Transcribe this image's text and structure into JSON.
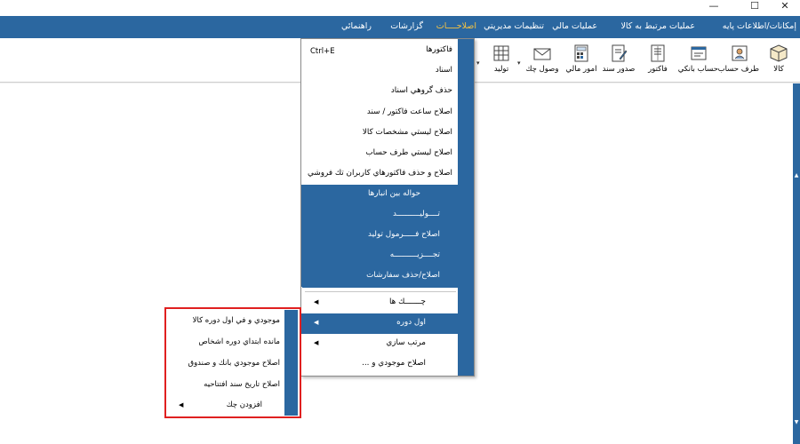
{
  "window": {
    "controls": {
      "minimize": "—",
      "maximize": "☐",
      "close": "✕"
    }
  },
  "menubar": {
    "items": [
      {
        "label": "إمكانات/اطلاعات پايه"
      },
      {
        "label": "عمليات مرتبط به كالا"
      },
      {
        "label": "عمليات مالي"
      },
      {
        "label": "تنظيمات مديريتي"
      },
      {
        "label": "اصلاحــــات"
      },
      {
        "label": "گزارشات"
      },
      {
        "label": "راهنمائي"
      }
    ],
    "active_index": 4,
    "active_color": "#f6c343"
  },
  "toolbar": {
    "items": [
      {
        "label": "كالا",
        "icon": "box-icon"
      },
      {
        "label": "طرف حساب",
        "icon": "contact-card-icon"
      },
      {
        "label": "حساب بانكي",
        "icon": "bank-account-icon"
      },
      {
        "label": "فاكتور",
        "icon": "invoice-icon"
      },
      {
        "label": "صدور سند",
        "icon": "document-edit-icon"
      },
      {
        "label": "امور مالي",
        "icon": "calculator-icon"
      },
      {
        "label": "وصول چك",
        "icon": "envelope-icon"
      },
      {
        "label": "توليد",
        "icon": "production-grid-icon"
      }
    ]
  },
  "dropdown": {
    "top_items": [
      {
        "label": "فاكتورها",
        "shortcut": "Ctrl+E"
      },
      {
        "label": "اسناد"
      },
      {
        "label": "حذف گروهي اسناد"
      },
      {
        "label": "اصلاح ساعت فاكتور / سند"
      },
      {
        "label": "اصلاح ليستي مشخصات كالا"
      },
      {
        "label": "اصلاح ليستي طرف حساب"
      },
      {
        "label": "اصلاح و حذف فاكتورهاي كاربران تك فروشي"
      }
    ],
    "blue_items": [
      {
        "label": "حواله بين انبارها"
      },
      {
        "label": "تــــوليــــــــــد"
      },
      {
        "label": "اصلاح فـــــرمول توليد"
      },
      {
        "label": "تجــــزيــــــــــه"
      },
      {
        "label": "اصلاح/حذف سفارشات"
      }
    ],
    "bottom_items": [
      {
        "label": "چـــــــك ها",
        "has_submenu": true
      },
      {
        "label": "اول دوره",
        "has_submenu": true,
        "highlighted": true
      },
      {
        "label": "مرتب سازي",
        "has_submenu": true
      },
      {
        "label": "اصلاح موجودي و ..."
      }
    ]
  },
  "submenu": {
    "items": [
      {
        "label": "موجودي و في اول دوره كالا"
      },
      {
        "label": "مانده ابتداي دوره اشخاص"
      },
      {
        "label": "اصلاح موجودي بانك و صندوق"
      },
      {
        "label": "اصلاح تاريخ سند افتتاحيه"
      },
      {
        "label": "افزودن چك",
        "has_submenu": true
      }
    ],
    "frame_color": "#e02020"
  },
  "colors": {
    "accent": "#2b67a0",
    "highlight_text": "#f6c343"
  }
}
